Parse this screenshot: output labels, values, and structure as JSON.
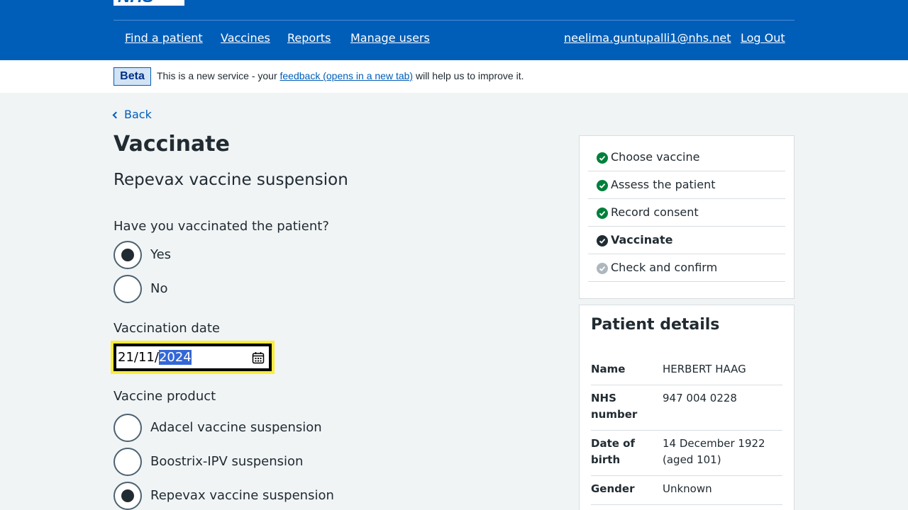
{
  "header": {
    "logo_text": "NHS",
    "nav": [
      "Find a patient",
      "Vaccines",
      "Reports",
      "Manage users"
    ],
    "user_email": "neelima.guntupalli1@nhs.net",
    "logout": "Log Out"
  },
  "banner": {
    "tag": "Beta",
    "text_before": "This is a new service - your",
    "link": "feedback (opens in a new tab)",
    "text_after": "will help us to improve it."
  },
  "back": "Back",
  "page": {
    "title": "Vaccinate",
    "subtitle": "Repevax vaccine suspension"
  },
  "vaccinated": {
    "question": "Have you vaccinated the patient?",
    "options": [
      "Yes",
      "No"
    ],
    "selected": "Yes"
  },
  "vaccination_date": {
    "label": "Vaccination date",
    "day_month": "21/11/",
    "year_selected": "2024"
  },
  "vaccine_product": {
    "label": "Vaccine product",
    "options": [
      "Adacel vaccine suspension",
      "Boostrix-IPV suspension",
      "Repevax vaccine suspension"
    ],
    "selected": "Repevax vaccine suspension"
  },
  "tasks": [
    {
      "label": "Choose vaccine",
      "status": "complete"
    },
    {
      "label": "Assess the patient",
      "status": "complete"
    },
    {
      "label": "Record consent",
      "status": "complete"
    },
    {
      "label": "Vaccinate",
      "status": "current"
    },
    {
      "label": "Check and confirm",
      "status": "pending"
    }
  ],
  "patient": {
    "heading": "Patient details",
    "rows": [
      {
        "key": "Name",
        "value": "HERBERT HAAG"
      },
      {
        "key": "NHS number",
        "value": "947 004 0228"
      },
      {
        "key": "Date of birth",
        "value": "14 December 1922 (aged 101)"
      },
      {
        "key": "Gender",
        "value": "Unknown"
      }
    ]
  },
  "colors": {
    "nhs_blue": "#005eb8",
    "complete_green": "#007f3b",
    "current_dark": "#212b32",
    "pending_grey": "#aeb7bd",
    "focus_yellow": "#ffeb3b"
  }
}
